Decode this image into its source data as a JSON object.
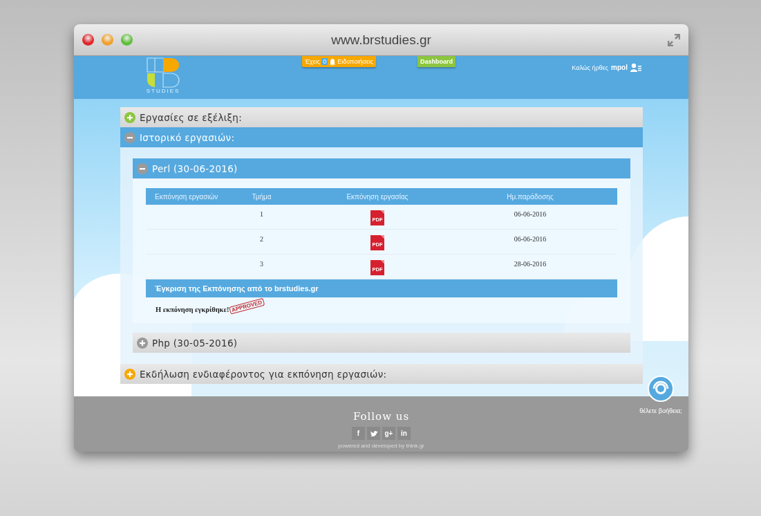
{
  "window": {
    "title": "www.brstudies.gr"
  },
  "header": {
    "logo_text": "STUDIES",
    "notifications": {
      "prefix": "Έχεις",
      "count": "0",
      "label": "Ειδοποιήσεις"
    },
    "dashboard": "Dashboard",
    "welcome": {
      "text": "Καλώς ήρθες",
      "user": "mpol"
    }
  },
  "sections": [
    {
      "title": "Εργασίες σε εξέλιξη:",
      "expanded": false,
      "color": "#8cc63f"
    },
    {
      "title": "Ιστορικό εργασιών:",
      "expanded": true,
      "color": "#9a9a9a",
      "projects": [
        {
          "title": "Perl (30-06-2016)",
          "expanded": true,
          "columns": [
            "Εκπόνηση εργασιών",
            "Τμήμα",
            "Εκπόνηση εργασίας",
            "Ημ.παράδοσης"
          ],
          "rows": [
            {
              "part": "1",
              "file": "PDF",
              "date": "06-06-2016"
            },
            {
              "part": "2",
              "file": "PDF",
              "date": "06-06-2016"
            },
            {
              "part": "3",
              "file": "PDF",
              "date": "28-06-2016"
            }
          ],
          "approval": {
            "heading": "Έγκριση της Εκπόνησης από το brstudies.gr",
            "text": "Η εκπόνηση εγκρίθηκε!",
            "stamp": "APPROVED"
          }
        },
        {
          "title": "Php (30-05-2016)",
          "expanded": false
        }
      ]
    },
    {
      "title": "Εκδήλωση ενδιαφέροντος για εκπόνηση εργασιών:",
      "expanded": false,
      "color": "#f7a800"
    }
  ],
  "help": {
    "label": "θέλετε βοήθεια;"
  },
  "footer": {
    "title": "Follow us",
    "social": [
      {
        "kind": "text",
        "label": "f"
      },
      {
        "kind": "bird"
      },
      {
        "kind": "text",
        "label": "g+"
      },
      {
        "kind": "text",
        "label": "in"
      }
    ],
    "note": "powered and developed by think.gr"
  }
}
